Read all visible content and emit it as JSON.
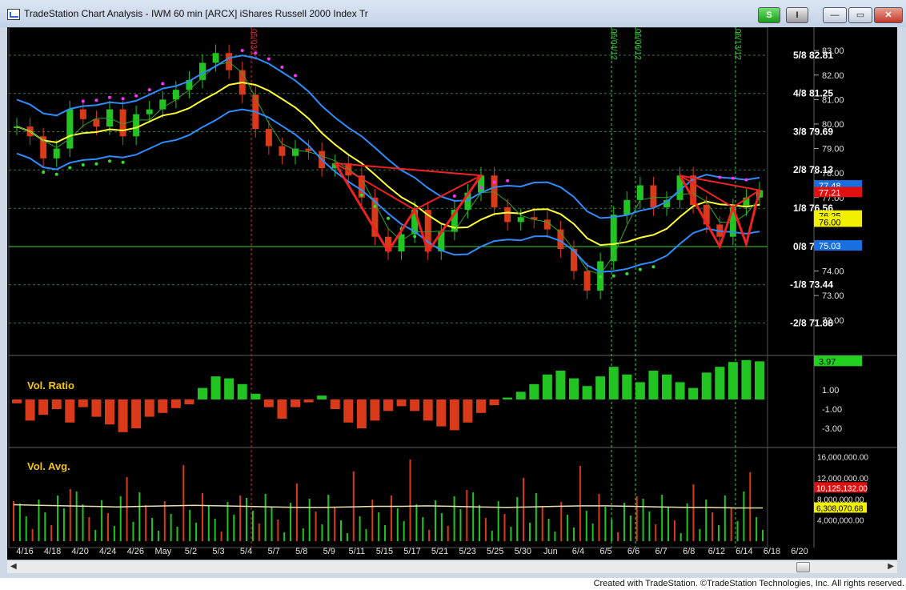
{
  "window": {
    "title": "TradeStation Chart Analysis - IWM 60 min [ARCX] iShares Russell 2000 Index Tr",
    "btn_s": "S",
    "btn_i": "I",
    "min_glyph": "—",
    "max_glyph": "▭",
    "close_glyph": "✕"
  },
  "footer": {
    "credit": "Created with TradeStation. ©TradeStation Technologies, Inc. All rights reserved."
  },
  "colors": {
    "background": "#000000",
    "up_bar": "#22c422",
    "down_bar": "#d83a1a",
    "bollinger": "#2f8cff",
    "ma_slow": "#ffff33",
    "ma_fast": "#2ca82c",
    "pattern": "#ee2222",
    "magenta_dots": "#ff33ff",
    "green_dots": "#33dd33",
    "label_text": "#ffffff",
    "vol_ratio_label": "#f5c600",
    "vol_avg_line": "#e8e0b0"
  },
  "chart_data": [
    {
      "type": "candlestick",
      "title": "IWM 60 min [ARCX]",
      "x_tick_labels": [
        "4/16",
        "4/18",
        "4/20",
        "4/24",
        "4/26",
        "May",
        "5/2",
        "5/3",
        "5/4",
        "5/7",
        "5/8",
        "5/9",
        "5/11",
        "5/15",
        "5/17",
        "5/21",
        "5/23",
        "5/25",
        "5/30",
        "Jun",
        "6/4",
        "6/5",
        "6/6",
        "6/7",
        "6/8",
        "6/12",
        "6/14",
        "6/18",
        "6/20"
      ],
      "y_ticks": [
        "83.00",
        "82.00",
        "81.00",
        "80.00",
        "79.00",
        "78.00",
        "77.00",
        "76.00",
        "75.00",
        "74.00",
        "73.00",
        "72.00"
      ],
      "ylim": [
        71.6,
        83.3
      ],
      "murrey_levels": [
        {
          "label": "5/8",
          "value": 82.81
        },
        {
          "label": "4/8",
          "value": 81.25
        },
        {
          "label": "3/8",
          "value": 79.69
        },
        {
          "label": "2/8",
          "value": 78.13
        },
        {
          "label": "1/8",
          "value": 76.56
        },
        {
          "label": "0/8",
          "value": 75.0
        },
        {
          "label": "-1/8",
          "value": 73.44
        },
        {
          "label": "-2/8",
          "value": 71.88
        }
      ],
      "price_tags": [
        {
          "value": "77.48",
          "color": "#1a6fe0"
        },
        {
          "value": "77.21",
          "color": "#e01010"
        },
        {
          "value": "76.25",
          "color": "#f0f000"
        },
        {
          "value": "76.00",
          "color": "#f0f000"
        },
        {
          "value": "75.03",
          "color": "#1a6fe0"
        }
      ],
      "vertical_markers": [
        "05/03/12",
        "06/04/12",
        "06/06/12",
        "06/13/12"
      ],
      "series": [
        {
          "name": "Close",
          "values": [
            79.9,
            79.5,
            78.6,
            79.0,
            80.6,
            80.2,
            79.9,
            80.6,
            79.5,
            80.4,
            80.6,
            81.0,
            81.4,
            81.8,
            82.5,
            82.9,
            82.2,
            81.2,
            79.8,
            79.1,
            78.7,
            79.0,
            78.9,
            78.2,
            78.4,
            77.9,
            77.0,
            75.4,
            74.8,
            75.5,
            76.5,
            74.8,
            75.6,
            76.5,
            77.2,
            77.9,
            76.6,
            76.0,
            76.2,
            76.1,
            75.7,
            74.9,
            74.0,
            73.2,
            74.4,
            76.3,
            76.9,
            77.5,
            76.6,
            76.9,
            77.9,
            76.7,
            75.9,
            75.4,
            76.6,
            77.0,
            77.3
          ]
        },
        {
          "name": "Vol. Ratio",
          "values": [
            -0.4,
            -2.2,
            -1.6,
            -1.0,
            -2.4,
            -0.8,
            -1.8,
            -2.6,
            -3.4,
            -3.0,
            -1.8,
            -1.4,
            -0.9,
            -0.5,
            1.2,
            2.4,
            2.2,
            1.6,
            0.6,
            -0.8,
            -2.0,
            -0.8,
            -0.3,
            0.4,
            -1.0,
            -2.4,
            -3.0,
            -2.2,
            -1.2,
            -0.7,
            -1.2,
            -2.2,
            -2.8,
            -3.2,
            -2.4,
            -1.4,
            -0.6,
            0.2,
            0.8,
            1.6,
            2.6,
            3.0,
            2.2,
            1.4,
            2.4,
            3.4,
            2.6,
            1.8,
            3.0,
            2.6,
            1.8,
            1.2,
            2.8,
            3.4,
            3.9,
            4.1,
            3.97
          ]
        },
        {
          "name": "Vol. Avg.",
          "values": [
            6.9,
            6.8,
            6.7,
            6.6,
            6.5,
            6.6,
            6.7,
            6.8,
            6.7,
            6.6,
            6.5,
            6.4,
            6.4,
            6.5,
            6.6,
            6.6,
            6.7,
            6.6,
            6.5,
            6.4,
            6.5,
            6.6,
            6.7,
            6.7,
            6.6,
            6.5,
            6.4,
            6.4,
            6.3,
            6.3
          ]
        }
      ],
      "vol_ratio": {
        "label": "Vol. Ratio",
        "ticks": [
          "1.00",
          "-1.00",
          "-3.00"
        ],
        "ylim": [
          -4.5,
          4.5
        ],
        "last_value": "3.97"
      },
      "vol_avg": {
        "label": "Vol. Avg.",
        "ticks": [
          "16,000,000.00",
          "12,000,000.00",
          "8,000,000.00",
          "4,000,000.00"
        ],
        "ylim": [
          0,
          17000000
        ],
        "tags": [
          {
            "value": "10,125,132.00",
            "color": "#e01010"
          },
          {
            "value": "6,308,070.68",
            "color": "#f0f000"
          }
        ]
      }
    }
  ]
}
